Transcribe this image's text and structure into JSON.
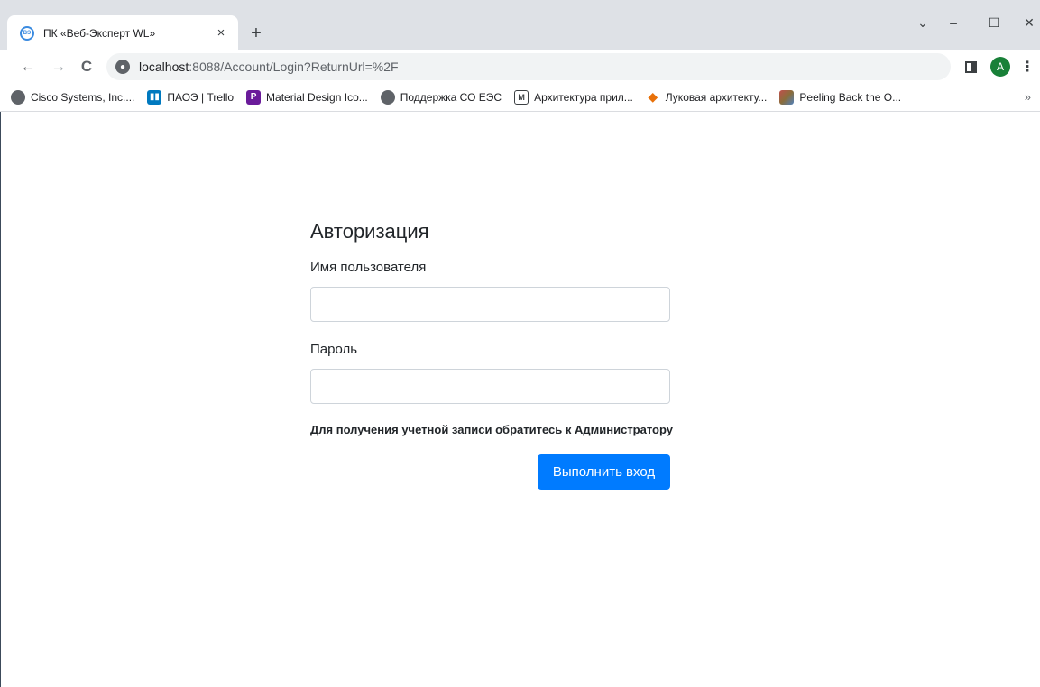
{
  "browser": {
    "tab": {
      "title": "ПК «Веб-Эксперт WL»",
      "favicon_text": "ВЭ",
      "close_glyph": "×"
    },
    "new_tab_glyph": "+",
    "window_controls": {
      "dropdown": "⌄",
      "minimize": "–",
      "maximize": "☐",
      "close": "✕"
    },
    "nav": {
      "back": "←",
      "forward": "→",
      "reload": "C"
    },
    "address": {
      "host": "localhost",
      "rest": ":8088/Account/Login?ReturnUrl=%2F"
    },
    "profile_initial": "A",
    "menu_glyph": "⋮",
    "bookmarks": [
      {
        "label": "Cisco Systems, Inc....",
        "icon": "globe-icon"
      },
      {
        "label": "ПАОЭ | Trello",
        "icon": "trello-icon"
      },
      {
        "label": "Material Design Ico...",
        "icon": "material-design-icon"
      },
      {
        "label": "Поддержка СО ЕЭС",
        "icon": "globe-icon"
      },
      {
        "label": "Архитектура прил...",
        "icon": "m-icon"
      },
      {
        "label": "Луковая архитекту...",
        "icon": "onion-icon"
      },
      {
        "label": "Peeling Back the O...",
        "icon": "image-icon"
      }
    ],
    "bookmarks_more": "»"
  },
  "login": {
    "title": "Авторизация",
    "username_label": "Имя пользователя",
    "username_value": "",
    "password_label": "Пароль",
    "password_value": "",
    "hint": "Для получения учетной записи обратитесь к Администратору",
    "submit_label": "Выполнить вход"
  },
  "colors": {
    "primary": "#007bff",
    "tabstrip": "#dee1e6",
    "profile": "#188038"
  }
}
